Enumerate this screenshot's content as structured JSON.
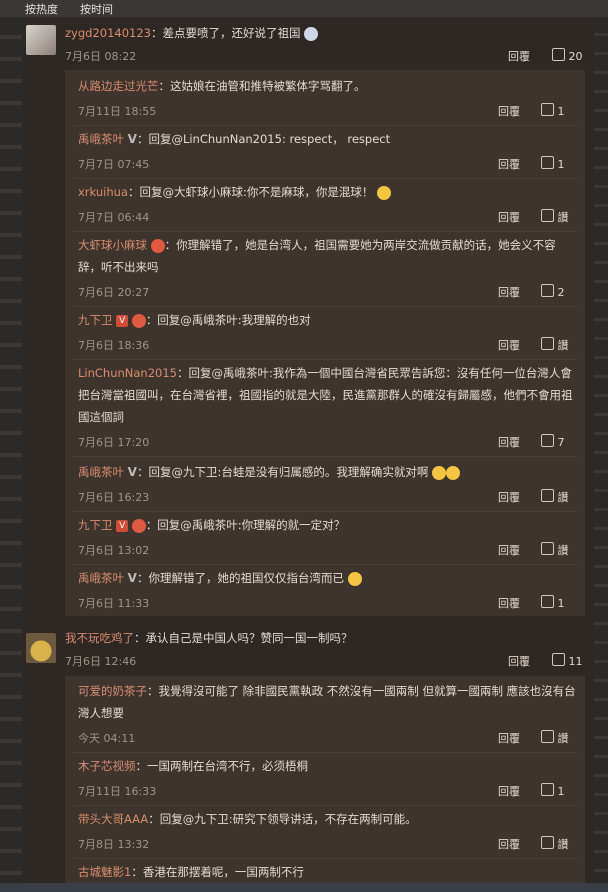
{
  "sort": {
    "hot": "按热度",
    "time": "按时间"
  },
  "comments": [
    {
      "user": "zygd20140123",
      "text": "：差点要喷了，还好说了祖国",
      "date": "7月6日 08:22",
      "reply": "回覆",
      "likes": "20",
      "replies": [
        {
          "user": "从路边走过光芒",
          "text": "：这姑娘在油管和推特被繁体字骂翻了。",
          "date": "7月11日 18:55",
          "reply": "回覆",
          "likes": "1"
        },
        {
          "user": "禹峨茶叶",
          "text": "：回复@LinChunNan2015: respect， respect",
          "date": "7月7日 07:45",
          "reply": "回覆",
          "likes": "1"
        },
        {
          "user": "xrkuihua",
          "text": "：回复@大虾球小麻球:你不是麻球，你是混球！",
          "date": "7月7日 06:44",
          "reply": "回覆",
          "likes": "讚"
        },
        {
          "user": "大虾球小麻球",
          "text": "：你理解错了，她是台湾人，祖国需要她为两岸交流做贡献的话，她会义不容辞，听不出来吗",
          "date": "7月6日 20:27",
          "reply": "回覆",
          "likes": "2"
        },
        {
          "user": "九下卫",
          "text": "：回复@禹峨茶叶:我理解的也对",
          "date": "7月6日 18:36",
          "reply": "回覆",
          "likes": "讚"
        },
        {
          "user": "LinChunNan2015",
          "text": "：回复@禹峨茶叶:我作為一個中國台灣省民眾告訴您：沒有任何一位台灣人會把台灣當祖國叫，在台灣省裡，祖國指的就是大陸，民進黨那群人的確沒有歸屬感，他們不會用祖國這個詞",
          "date": "7月6日 17:20",
          "reply": "回覆",
          "likes": "7"
        },
        {
          "user": "禹峨茶叶",
          "text": "：回复@九下卫:台蛙是没有归属感的。我理解确实就对啊",
          "date": "7月6日 16:23",
          "reply": "回覆",
          "likes": "讚"
        },
        {
          "user": "九下卫",
          "text": "：回复@禹峨茶叶:你理解的就一定对？",
          "date": "7月6日 13:02",
          "reply": "回覆",
          "likes": "讚"
        },
        {
          "user": "禹峨茶叶",
          "text": "：你理解错了，她的祖国仅仅指台湾而已",
          "date": "7月6日 11:33",
          "reply": "回覆",
          "likes": "1"
        }
      ]
    },
    {
      "user": "我不玩吃鸡了",
      "text": "：承认自己是中国人吗？赞同一国一制吗？",
      "date": "7月6日 12:46",
      "reply": "回覆",
      "likes": "11",
      "replies": [
        {
          "user": "可爱的奶茶子",
          "text": "：我覺得沒可能了 除非國民黨執政 不然沒有一國兩制 但就算一國兩制 應該也沒有台灣人想要",
          "date": "今天 04:11",
          "reply": "回覆",
          "likes": "讚"
        },
        {
          "user": "木子芯视频",
          "text": "：一国两制在台湾不行，必须梧桐",
          "date": "7月11日 16:33",
          "reply": "回覆",
          "likes": "1"
        },
        {
          "user": "带头大哥AAA",
          "text": "：回复@九下卫:研究下领导讲话，不存在两制可能。",
          "date": "7月8日 13:32",
          "reply": "回覆",
          "likes": "讚"
        },
        {
          "user": "古城魅影1",
          "text": "：香港在那摆着呢，一国两制不行",
          "date": "",
          "reply": "",
          "likes": ""
        }
      ]
    }
  ]
}
